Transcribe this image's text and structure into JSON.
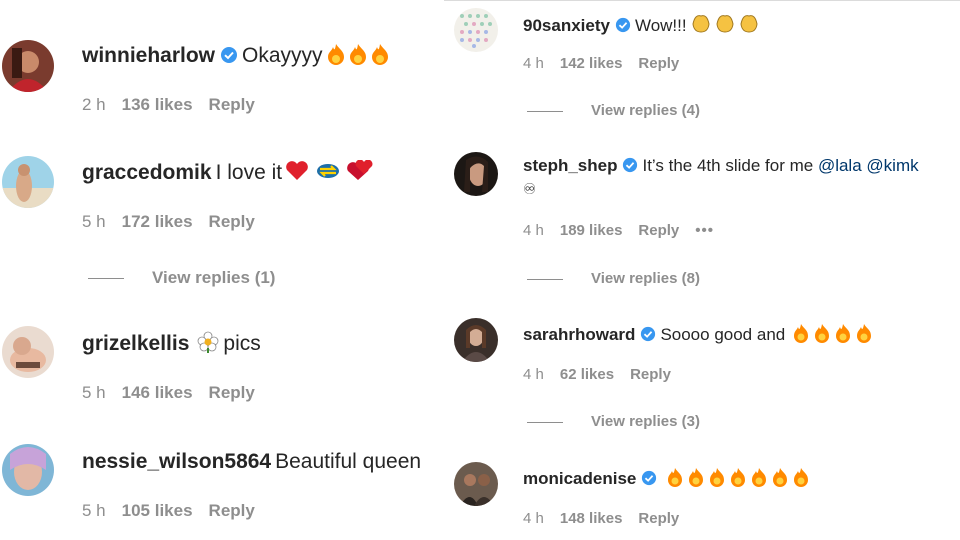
{
  "left_comments": [
    {
      "username": "winnieharlow",
      "verified": true,
      "text": "Okayyyy",
      "emoji_count": 3,
      "emoji_kind": "fire",
      "time": "2 h",
      "likes": "136 likes",
      "reply": "Reply"
    },
    {
      "username": "graccedomik",
      "verified": false,
      "text": "I love it",
      "emoji_kind": "mixed",
      "time": "5 h",
      "likes": "172 likes",
      "reply": "Reply",
      "view_replies": "View replies (1)"
    },
    {
      "username": "grizelkellis",
      "verified": false,
      "text": "pics",
      "emoji_kind": "flower",
      "time": "5 h",
      "likes": "146 likes",
      "reply": "Reply"
    },
    {
      "username": "nessie_wilson5864",
      "verified": false,
      "text": "Beautiful queen",
      "time": "5 h",
      "likes": "105 likes",
      "reply": "Reply"
    }
  ],
  "right_comments": [
    {
      "username": "90sanxiety",
      "verified": true,
      "text": "Wow!!!",
      "emoji_count": 3,
      "emoji_kind": "clap",
      "time": "4 h",
      "likes": "142 likes",
      "reply": "Reply",
      "view_replies": "View replies (4)"
    },
    {
      "username": "steph_shep",
      "verified": true,
      "text": "It’s the 4th slide for me",
      "mention1": "@lala",
      "mention2": "@kimk",
      "line2": "♾",
      "time": "4 h",
      "likes": "189 likes",
      "reply": "Reply",
      "more": "•••",
      "view_replies": "View replies (8)"
    },
    {
      "username": "sarahrhoward",
      "verified": true,
      "text": "Soooo good and",
      "emoji_count": 4,
      "emoji_kind": "fire",
      "time": "4 h",
      "likes": "62 likes",
      "reply": "Reply",
      "view_replies": "View replies (3)"
    },
    {
      "username": "monicadenise",
      "verified": true,
      "text": "",
      "emoji_count": 7,
      "emoji_kind": "fire",
      "time": "4 h",
      "likes": "148 likes",
      "reply": "Reply"
    }
  ],
  "colors": {
    "verified": "#3897f0",
    "meta": "#8e8e8e",
    "text": "#262626",
    "mention": "#00376b",
    "fire": "#ff8a00",
    "clap": "#f5c242"
  },
  "icons": {
    "verified": "verified-badge-icon",
    "fire": "fire-emoji-icon",
    "clap": "clap-emoji-icon",
    "heart": "red-heart-emoji-icon",
    "flower": "flower-emoji-icon"
  }
}
